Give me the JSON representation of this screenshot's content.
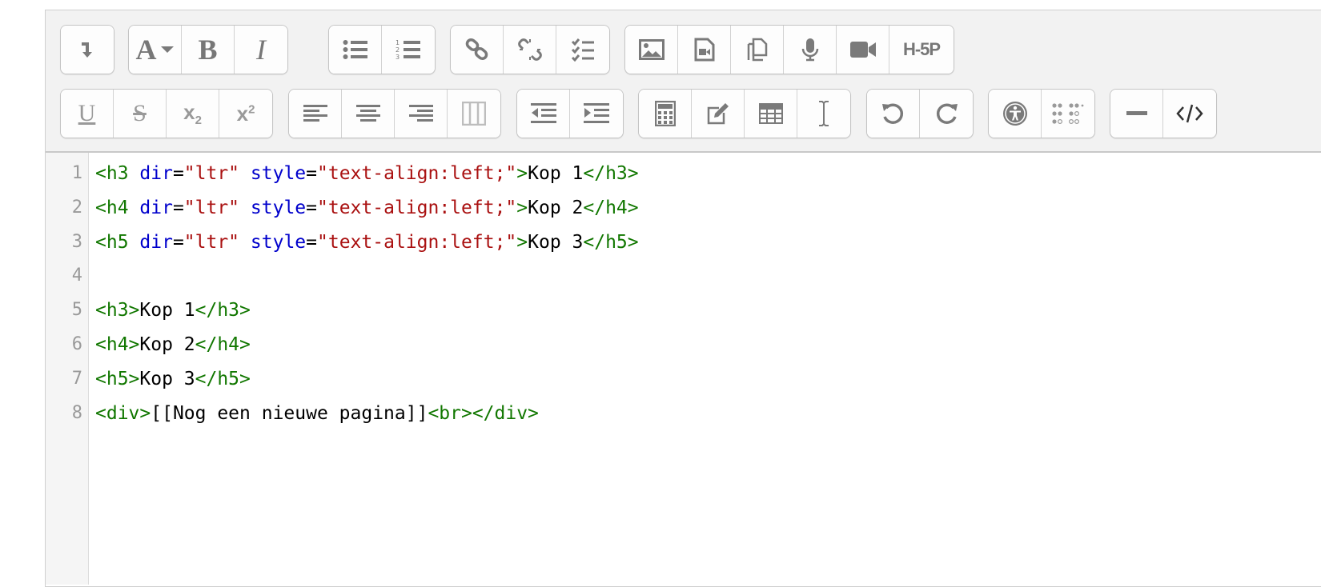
{
  "toolbar": {
    "row1": [
      {
        "groups": [
          [
            "collapse"
          ]
        ]
      },
      {
        "groups": [
          [
            "font-style",
            "bold",
            "italic"
          ]
        ]
      },
      {
        "groups": [
          [
            "unordered-list",
            "ordered-list"
          ]
        ]
      },
      {
        "groups": [
          [
            "link",
            "unlink",
            "manage-list"
          ]
        ]
      },
      {
        "groups": [
          [
            "image",
            "media",
            "manage-files",
            "record-audio",
            "record-video",
            "h5p"
          ]
        ]
      }
    ],
    "bold_label": "B",
    "italic_label": "I",
    "font_label": "A",
    "h5p_label": "H-5P",
    "underline_label": "U",
    "strike_label": "S",
    "subscript_label": "x",
    "subscript_small": "2",
    "superscript_label": "x",
    "superscript_small": "2"
  },
  "code_lines": [
    {
      "num": "1",
      "tokens": [
        [
          "tag",
          "<h3 "
        ],
        [
          "attr",
          "dir"
        ],
        [
          "txt",
          "="
        ],
        [
          "str",
          "\"ltr\""
        ],
        [
          "txt",
          " "
        ],
        [
          "attr",
          "style"
        ],
        [
          "txt",
          "="
        ],
        [
          "str",
          "\"text-align:left;\""
        ],
        [
          "tag",
          ">"
        ],
        [
          "txt",
          "Kop 1"
        ],
        [
          "tag",
          "</h3>"
        ]
      ]
    },
    {
      "num": "2",
      "tokens": [
        [
          "tag",
          "<h4 "
        ],
        [
          "attr",
          "dir"
        ],
        [
          "txt",
          "="
        ],
        [
          "str",
          "\"ltr\""
        ],
        [
          "txt",
          " "
        ],
        [
          "attr",
          "style"
        ],
        [
          "txt",
          "="
        ],
        [
          "str",
          "\"text-align:left;\""
        ],
        [
          "tag",
          ">"
        ],
        [
          "txt",
          "Kop 2"
        ],
        [
          "tag",
          "</h4>"
        ]
      ]
    },
    {
      "num": "3",
      "tokens": [
        [
          "tag",
          "<h5 "
        ],
        [
          "attr",
          "dir"
        ],
        [
          "txt",
          "="
        ],
        [
          "str",
          "\"ltr\""
        ],
        [
          "txt",
          " "
        ],
        [
          "attr",
          "style"
        ],
        [
          "txt",
          "="
        ],
        [
          "str",
          "\"text-align:left;\""
        ],
        [
          "tag",
          ">"
        ],
        [
          "txt",
          "Kop 3"
        ],
        [
          "tag",
          "</h5>"
        ]
      ]
    },
    {
      "num": "4",
      "tokens": []
    },
    {
      "num": "5",
      "tokens": [
        [
          "tag",
          "<h3>"
        ],
        [
          "txt",
          "Kop 1"
        ],
        [
          "tag",
          "</h3>"
        ]
      ]
    },
    {
      "num": "6",
      "tokens": [
        [
          "tag",
          "<h4>"
        ],
        [
          "txt",
          "Kop 2"
        ],
        [
          "tag",
          "</h4>"
        ]
      ]
    },
    {
      "num": "7",
      "tokens": [
        [
          "tag",
          "<h5>"
        ],
        [
          "txt",
          "Kop 3"
        ],
        [
          "tag",
          "</h5>"
        ]
      ]
    },
    {
      "num": "8",
      "tokens": [
        [
          "tag",
          "<div>"
        ],
        [
          "txt",
          "[[Nog een nieuwe pagina]]"
        ],
        [
          "tag",
          "<br></div>"
        ]
      ]
    }
  ],
  "colors": {
    "tag": "#117700",
    "attr": "#0000cc",
    "string": "#aa1111",
    "text": "#000000",
    "icon": "#7a7a7a"
  }
}
